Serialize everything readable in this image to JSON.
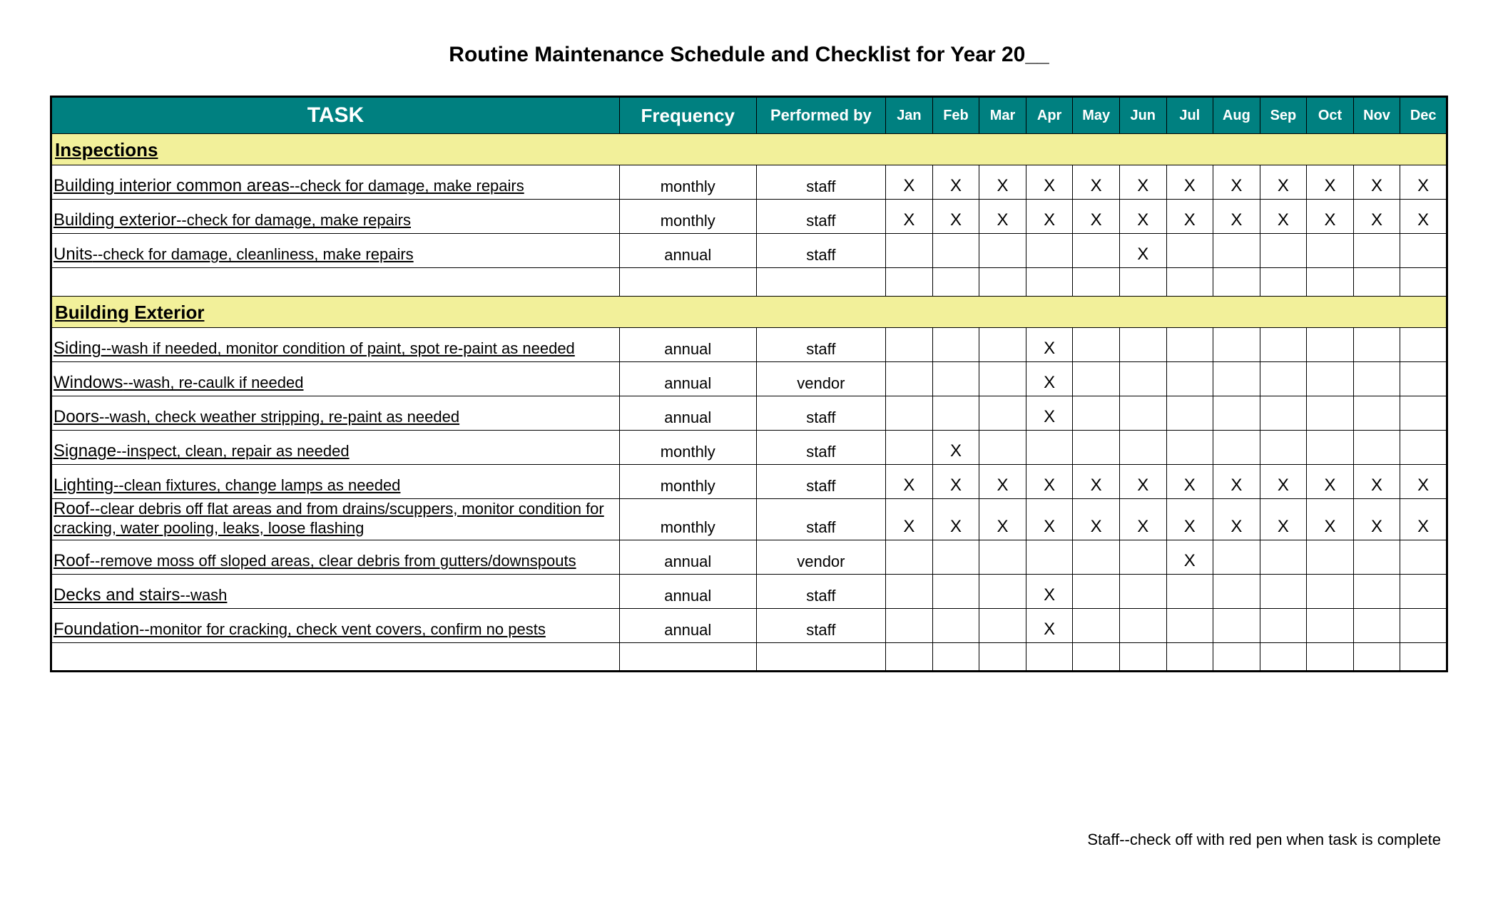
{
  "title": "Routine Maintenance Schedule and Checklist for Year 20__",
  "columns": {
    "task": "TASK",
    "frequency": "Frequency",
    "performed_by": "Performed by",
    "months": [
      "Jan",
      "Feb",
      "Mar",
      "Apr",
      "May",
      "Jun",
      "Jul",
      "Aug",
      "Sep",
      "Oct",
      "Nov",
      "Dec"
    ]
  },
  "mark_glyph": "X",
  "sections": [
    {
      "heading": "Inspections",
      "rows": [
        {
          "name": "Building interior common areas",
          "desc": "--check for damage, make repairs",
          "frequency": "monthly",
          "performed_by": "staff",
          "months": [
            1,
            1,
            1,
            1,
            1,
            1,
            1,
            1,
            1,
            1,
            1,
            1
          ]
        },
        {
          "name": "Building exterior",
          "desc": "--check for damage, make repairs",
          "frequency": "monthly",
          "performed_by": "staff",
          "months": [
            1,
            1,
            1,
            1,
            1,
            1,
            1,
            1,
            1,
            1,
            1,
            1
          ]
        },
        {
          "name": "Units",
          "desc": "--check for damage, cleanliness, make repairs",
          "frequency": "annual",
          "performed_by": "staff",
          "months": [
            0,
            0,
            0,
            0,
            0,
            1,
            0,
            0,
            0,
            0,
            0,
            0
          ]
        }
      ],
      "trailing_spacer": true
    },
    {
      "heading": "Building Exterior",
      "rows": [
        {
          "name": "Siding",
          "desc": "--wash if needed, monitor condition of paint, spot re-paint as needed",
          "frequency": "annual",
          "performed_by": "staff",
          "months": [
            0,
            0,
            0,
            1,
            0,
            0,
            0,
            0,
            0,
            0,
            0,
            0
          ]
        },
        {
          "name": "Windows",
          "desc": "--wash, re-caulk if needed",
          "frequency": "annual",
          "performed_by": "vendor",
          "months": [
            0,
            0,
            0,
            1,
            0,
            0,
            0,
            0,
            0,
            0,
            0,
            0
          ]
        },
        {
          "name": "Doors",
          "desc": "--wash, check weather stripping, re-paint as needed",
          "frequency": "annual",
          "performed_by": "staff",
          "months": [
            0,
            0,
            0,
            1,
            0,
            0,
            0,
            0,
            0,
            0,
            0,
            0
          ]
        },
        {
          "name": "Signage",
          "desc": "--inspect, clean, repair as needed",
          "frequency": "monthly",
          "performed_by": "staff",
          "months": [
            0,
            1,
            0,
            0,
            0,
            0,
            0,
            0,
            0,
            0,
            0,
            0
          ]
        },
        {
          "name": "Lighting",
          "desc": "--clean fixtures, change lamps as needed",
          "frequency": "monthly",
          "performed_by": "staff",
          "months": [
            1,
            1,
            1,
            1,
            1,
            1,
            1,
            1,
            1,
            1,
            1,
            1
          ]
        },
        {
          "name": "Roof",
          "desc": "--clear debris off flat areas and from drains/scuppers, monitor condition for cracking, water pooling, leaks, loose flashing",
          "frequency": "monthly",
          "performed_by": "staff",
          "months": [
            1,
            1,
            1,
            1,
            1,
            1,
            1,
            1,
            1,
            1,
            1,
            1
          ],
          "tall": true
        },
        {
          "name": "Roof",
          "desc": "--remove moss off sloped areas, clear debris from gutters/downspouts",
          "frequency": "annual",
          "performed_by": "vendor",
          "months": [
            0,
            0,
            0,
            0,
            0,
            0,
            1,
            0,
            0,
            0,
            0,
            0
          ]
        },
        {
          "name": "Decks and stairs",
          "desc": "--wash",
          "frequency": "annual",
          "performed_by": "staff",
          "months": [
            0,
            0,
            0,
            1,
            0,
            0,
            0,
            0,
            0,
            0,
            0,
            0
          ]
        },
        {
          "name": "Foundation",
          "desc": "--monitor for cracking, check vent covers, confirm no pests",
          "frequency": "annual",
          "performed_by": "staff",
          "months": [
            0,
            0,
            0,
            1,
            0,
            0,
            0,
            0,
            0,
            0,
            0,
            0
          ]
        }
      ],
      "trailing_spacer": true
    }
  ],
  "footnote": "Staff--check off with red pen when task is complete"
}
